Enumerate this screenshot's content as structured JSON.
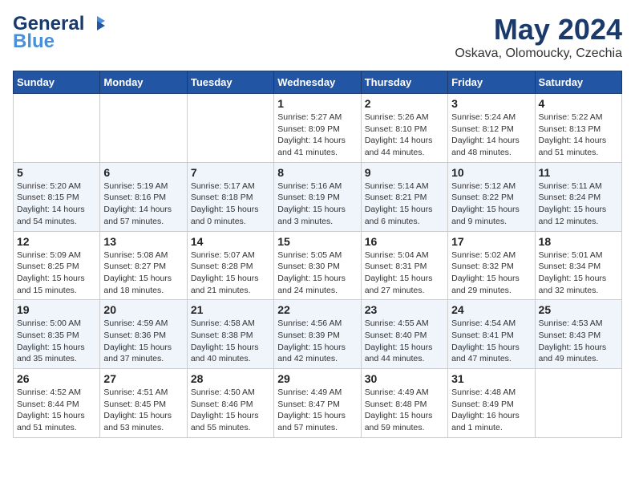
{
  "header": {
    "logo_line1": "General",
    "logo_line2": "Blue",
    "month": "May 2024",
    "location": "Oskava, Olomoucky, Czechia"
  },
  "weekdays": [
    "Sunday",
    "Monday",
    "Tuesday",
    "Wednesday",
    "Thursday",
    "Friday",
    "Saturday"
  ],
  "weeks": [
    [
      {
        "day": "",
        "text": ""
      },
      {
        "day": "",
        "text": ""
      },
      {
        "day": "",
        "text": ""
      },
      {
        "day": "1",
        "text": "Sunrise: 5:27 AM\nSunset: 8:09 PM\nDaylight: 14 hours and 41 minutes."
      },
      {
        "day": "2",
        "text": "Sunrise: 5:26 AM\nSunset: 8:10 PM\nDaylight: 14 hours and 44 minutes."
      },
      {
        "day": "3",
        "text": "Sunrise: 5:24 AM\nSunset: 8:12 PM\nDaylight: 14 hours and 48 minutes."
      },
      {
        "day": "4",
        "text": "Sunrise: 5:22 AM\nSunset: 8:13 PM\nDaylight: 14 hours and 51 minutes."
      }
    ],
    [
      {
        "day": "5",
        "text": "Sunrise: 5:20 AM\nSunset: 8:15 PM\nDaylight: 14 hours and 54 minutes."
      },
      {
        "day": "6",
        "text": "Sunrise: 5:19 AM\nSunset: 8:16 PM\nDaylight: 14 hours and 57 minutes."
      },
      {
        "day": "7",
        "text": "Sunrise: 5:17 AM\nSunset: 8:18 PM\nDaylight: 15 hours and 0 minutes."
      },
      {
        "day": "8",
        "text": "Sunrise: 5:16 AM\nSunset: 8:19 PM\nDaylight: 15 hours and 3 minutes."
      },
      {
        "day": "9",
        "text": "Sunrise: 5:14 AM\nSunset: 8:21 PM\nDaylight: 15 hours and 6 minutes."
      },
      {
        "day": "10",
        "text": "Sunrise: 5:12 AM\nSunset: 8:22 PM\nDaylight: 15 hours and 9 minutes."
      },
      {
        "day": "11",
        "text": "Sunrise: 5:11 AM\nSunset: 8:24 PM\nDaylight: 15 hours and 12 minutes."
      }
    ],
    [
      {
        "day": "12",
        "text": "Sunrise: 5:09 AM\nSunset: 8:25 PM\nDaylight: 15 hours and 15 minutes."
      },
      {
        "day": "13",
        "text": "Sunrise: 5:08 AM\nSunset: 8:27 PM\nDaylight: 15 hours and 18 minutes."
      },
      {
        "day": "14",
        "text": "Sunrise: 5:07 AM\nSunset: 8:28 PM\nDaylight: 15 hours and 21 minutes."
      },
      {
        "day": "15",
        "text": "Sunrise: 5:05 AM\nSunset: 8:30 PM\nDaylight: 15 hours and 24 minutes."
      },
      {
        "day": "16",
        "text": "Sunrise: 5:04 AM\nSunset: 8:31 PM\nDaylight: 15 hours and 27 minutes."
      },
      {
        "day": "17",
        "text": "Sunrise: 5:02 AM\nSunset: 8:32 PM\nDaylight: 15 hours and 29 minutes."
      },
      {
        "day": "18",
        "text": "Sunrise: 5:01 AM\nSunset: 8:34 PM\nDaylight: 15 hours and 32 minutes."
      }
    ],
    [
      {
        "day": "19",
        "text": "Sunrise: 5:00 AM\nSunset: 8:35 PM\nDaylight: 15 hours and 35 minutes."
      },
      {
        "day": "20",
        "text": "Sunrise: 4:59 AM\nSunset: 8:36 PM\nDaylight: 15 hours and 37 minutes."
      },
      {
        "day": "21",
        "text": "Sunrise: 4:58 AM\nSunset: 8:38 PM\nDaylight: 15 hours and 40 minutes."
      },
      {
        "day": "22",
        "text": "Sunrise: 4:56 AM\nSunset: 8:39 PM\nDaylight: 15 hours and 42 minutes."
      },
      {
        "day": "23",
        "text": "Sunrise: 4:55 AM\nSunset: 8:40 PM\nDaylight: 15 hours and 44 minutes."
      },
      {
        "day": "24",
        "text": "Sunrise: 4:54 AM\nSunset: 8:41 PM\nDaylight: 15 hours and 47 minutes."
      },
      {
        "day": "25",
        "text": "Sunrise: 4:53 AM\nSunset: 8:43 PM\nDaylight: 15 hours and 49 minutes."
      }
    ],
    [
      {
        "day": "26",
        "text": "Sunrise: 4:52 AM\nSunset: 8:44 PM\nDaylight: 15 hours and 51 minutes."
      },
      {
        "day": "27",
        "text": "Sunrise: 4:51 AM\nSunset: 8:45 PM\nDaylight: 15 hours and 53 minutes."
      },
      {
        "day": "28",
        "text": "Sunrise: 4:50 AM\nSunset: 8:46 PM\nDaylight: 15 hours and 55 minutes."
      },
      {
        "day": "29",
        "text": "Sunrise: 4:49 AM\nSunset: 8:47 PM\nDaylight: 15 hours and 57 minutes."
      },
      {
        "day": "30",
        "text": "Sunrise: 4:49 AM\nSunset: 8:48 PM\nDaylight: 15 hours and 59 minutes."
      },
      {
        "day": "31",
        "text": "Sunrise: 4:48 AM\nSunset: 8:49 PM\nDaylight: 16 hours and 1 minute."
      },
      {
        "day": "",
        "text": ""
      }
    ]
  ]
}
